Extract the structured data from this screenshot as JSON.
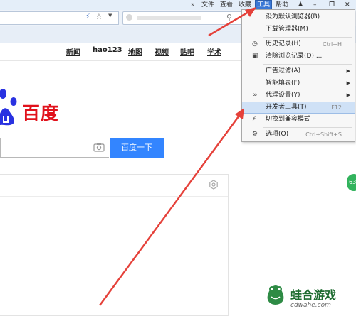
{
  "menubar": {
    "items": [
      "»",
      "文件",
      "查看",
      "收藏",
      "工具",
      "帮助"
    ],
    "active": "工具"
  },
  "page": {
    "nav": [
      "新闻",
      "hao123",
      "地图",
      "视频",
      "贴吧",
      "学术"
    ],
    "logo_text": "百度",
    "search_button": "百度一下",
    "badge": "63"
  },
  "tools_menu": {
    "items": [
      {
        "label": "设为默认浏览器(B)",
        "shortcut": "",
        "icon": "",
        "submenu": false
      },
      {
        "label": "下载管理器(M)",
        "shortcut": "",
        "icon": "",
        "submenu": false
      },
      {
        "label": "历史记录(H)",
        "shortcut": "Ctrl+H",
        "icon": "clock-icon",
        "submenu": false
      },
      {
        "label": "清除浏览记录(D) ...",
        "shortcut": "",
        "icon": "trash-icon",
        "submenu": false
      },
      {
        "label": "广告过滤(A)",
        "shortcut": "",
        "icon": "",
        "submenu": true
      },
      {
        "label": "智能填表(F)",
        "shortcut": "",
        "icon": "",
        "submenu": true
      },
      {
        "label": "代理设置(Y)",
        "shortcut": "",
        "icon": "link-icon",
        "submenu": true
      },
      {
        "label": "开发者工具(T)",
        "shortcut": "F12",
        "icon": "",
        "submenu": false,
        "highlighted": true
      },
      {
        "label": "切换到兼容模式",
        "shortcut": "",
        "icon": "lightning-icon",
        "submenu": false
      },
      {
        "label": "选项(O)",
        "shortcut": "Ctrl+Shift+S",
        "icon": "gear-icon",
        "submenu": false
      }
    ]
  },
  "watermark": {
    "title": "蛙合游戏",
    "url": "cdwahe.com"
  },
  "colors": {
    "menu_highlight": "#cfe1f6",
    "active_menu": "#3a78d6",
    "search_button": "#3385ff",
    "annotation_arrow": "#e5413a",
    "logo_red": "#e1111b",
    "logo_blue": "#2932e1"
  }
}
